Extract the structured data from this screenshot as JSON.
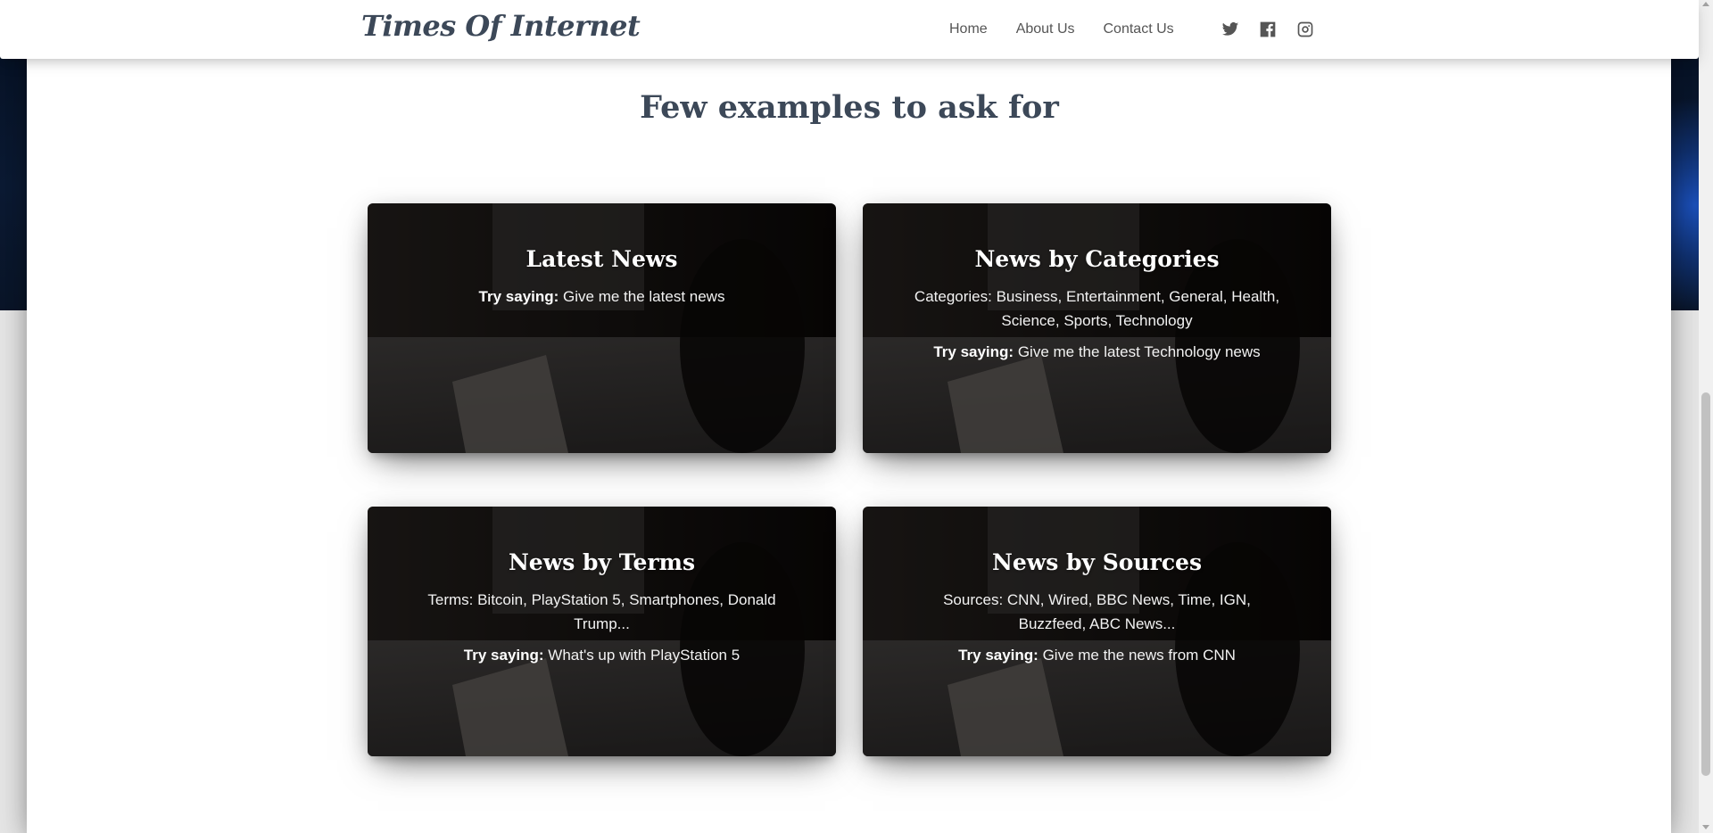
{
  "navbar": {
    "brand": "Times Of Internet",
    "links": [
      "Home",
      "About Us",
      "Contact Us"
    ],
    "icons": [
      "twitter-icon",
      "facebook-icon",
      "instagram-icon"
    ]
  },
  "section": {
    "title": "Few examples to ask for"
  },
  "cards": [
    {
      "title": "Latest News",
      "details": "",
      "try_label": "Try saying:",
      "try_text": " Give me the latest news"
    },
    {
      "title": "News by Categories",
      "details": "Categories: Business, Entertainment, General, Health, Science, Sports, Technology",
      "try_label": "Try saying:",
      "try_text": " Give me the latest Technology news"
    },
    {
      "title": "News by Terms",
      "details": "Terms: Bitcoin, PlayStation 5, Smartphones, Donald Trump...",
      "try_label": "Try saying:",
      "try_text": " What's up with PlayStation 5"
    },
    {
      "title": "News by Sources",
      "details": "Sources: CNN, Wired, BBC News, Time, IGN, Buzzfeed, ABC News...",
      "try_label": "Try saying:",
      "try_text": " Give me the news from CNN"
    }
  ],
  "colors": {
    "heading": "#3c4858",
    "nav_text": "#555555",
    "card_overlay": "#000000"
  }
}
